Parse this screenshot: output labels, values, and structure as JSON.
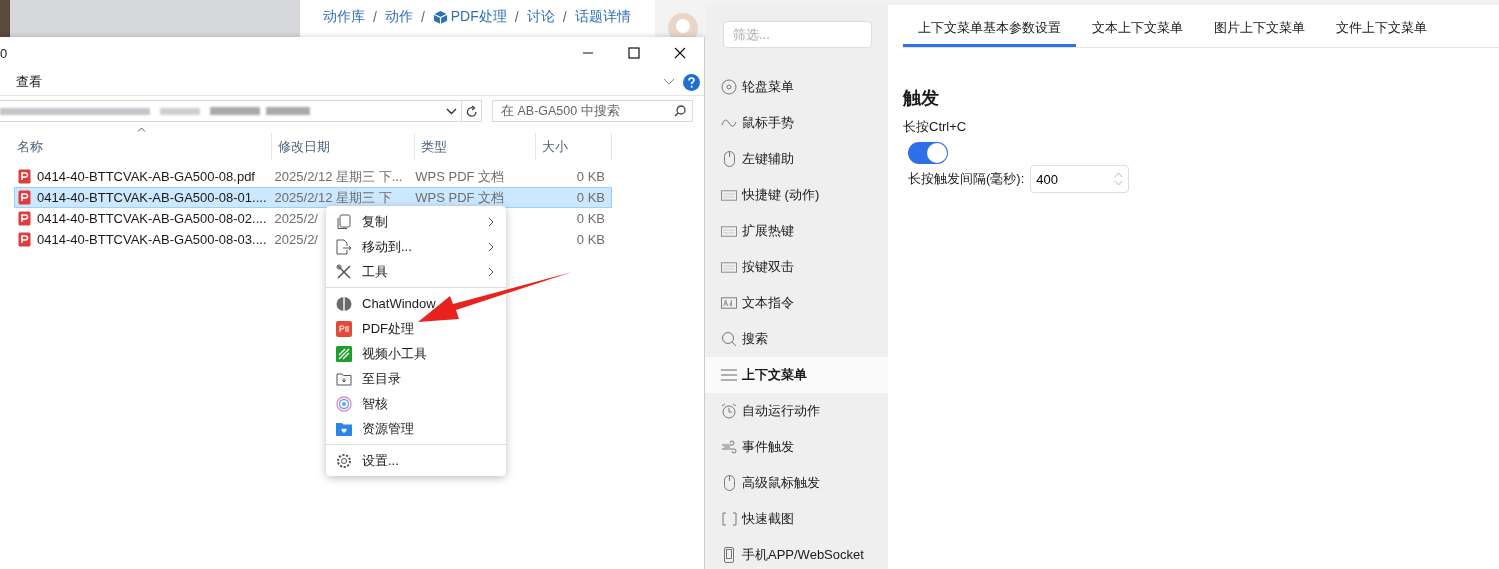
{
  "breadcrumb": {
    "separator": "/",
    "items": [
      {
        "label": "动作库",
        "icon": false
      },
      {
        "label": "动作",
        "icon": false
      },
      {
        "label": "PDF处理",
        "icon": true
      },
      {
        "label": "讨论",
        "icon": false
      },
      {
        "label": "话题详情",
        "icon": false
      }
    ]
  },
  "explorer": {
    "title": "0",
    "menu": [
      "查看"
    ],
    "search": {
      "placeholder": "在 AB-GA500 中搜索"
    },
    "columns": [
      "名称",
      "修改日期",
      "类型",
      "大小"
    ],
    "rows": [
      {
        "name": "0414-40-BTTCVAK-AB-GA500-08.pdf",
        "date": "2025/2/12 星期三 下...",
        "type": "WPS PDF 文档",
        "size": "0 KB",
        "selected": false
      },
      {
        "name": "0414-40-BTTCVAK-AB-GA500-08-01....",
        "date": "2025/2/12 星期三 下",
        "type": "WPS PDF 文档",
        "size": "0 KB",
        "selected": true
      },
      {
        "name": "0414-40-BTTCVAK-AB-GA500-08-02....",
        "date": "2025/2/",
        "size": "0 KB",
        "selected": false
      },
      {
        "name": "0414-40-BTTCVAK-AB-GA500-08-03....",
        "date": "2025/2/",
        "size": "0 KB",
        "selected": false
      }
    ]
  },
  "context_menu": [
    {
      "kind": "item",
      "label": "复制",
      "submenu": true
    },
    {
      "kind": "item",
      "label": "移动到...",
      "submenu": true
    },
    {
      "kind": "item",
      "label": "工具",
      "submenu": true
    },
    {
      "kind": "separator"
    },
    {
      "kind": "item",
      "label": "ChatWindow",
      "submenu": false
    },
    {
      "kind": "item",
      "label": "PDF处理",
      "submenu": false
    },
    {
      "kind": "item",
      "label": "视频小工具",
      "submenu": false
    },
    {
      "kind": "item",
      "label": "至目录",
      "submenu": false
    },
    {
      "kind": "item",
      "label": "智核",
      "submenu": false
    },
    {
      "kind": "item",
      "label": "资源管理",
      "submenu": false
    },
    {
      "kind": "separator"
    },
    {
      "kind": "item",
      "label": "设置...",
      "submenu": false
    }
  ],
  "app": {
    "filter": {
      "placeholder": "筛选..."
    },
    "sidebar": [
      {
        "label": "轮盘菜单",
        "selected": false
      },
      {
        "label": "鼠标手势",
        "selected": false
      },
      {
        "label": "左键辅助",
        "selected": false
      },
      {
        "label": "快捷键 (动作)",
        "selected": false
      },
      {
        "label": "扩展热键",
        "selected": false
      },
      {
        "label": "按键双击",
        "selected": false
      },
      {
        "label": "文本指令",
        "selected": false
      },
      {
        "label": "搜索",
        "selected": false
      },
      {
        "label": "上下文菜单",
        "selected": true
      },
      {
        "label": "自动运行动作",
        "selected": false
      },
      {
        "label": "事件触发",
        "selected": false
      },
      {
        "label": "高级鼠标触发",
        "selected": false
      },
      {
        "label": "快速截图",
        "selected": false
      },
      {
        "label": "手机APP/WebSocket",
        "selected": false
      }
    ],
    "tabs": [
      {
        "label": "上下文菜单基本参数设置",
        "selected": true
      },
      {
        "label": "文本上下文菜单",
        "selected": false
      },
      {
        "label": "图片上下文菜单",
        "selected": false
      },
      {
        "label": "文件上下文菜单",
        "selected": false
      }
    ],
    "section": "触发",
    "toggle": {
      "label": "长按Ctrl+C",
      "on": true
    },
    "field": {
      "label": "长按触发间隔(毫秒):",
      "value": "400"
    }
  }
}
